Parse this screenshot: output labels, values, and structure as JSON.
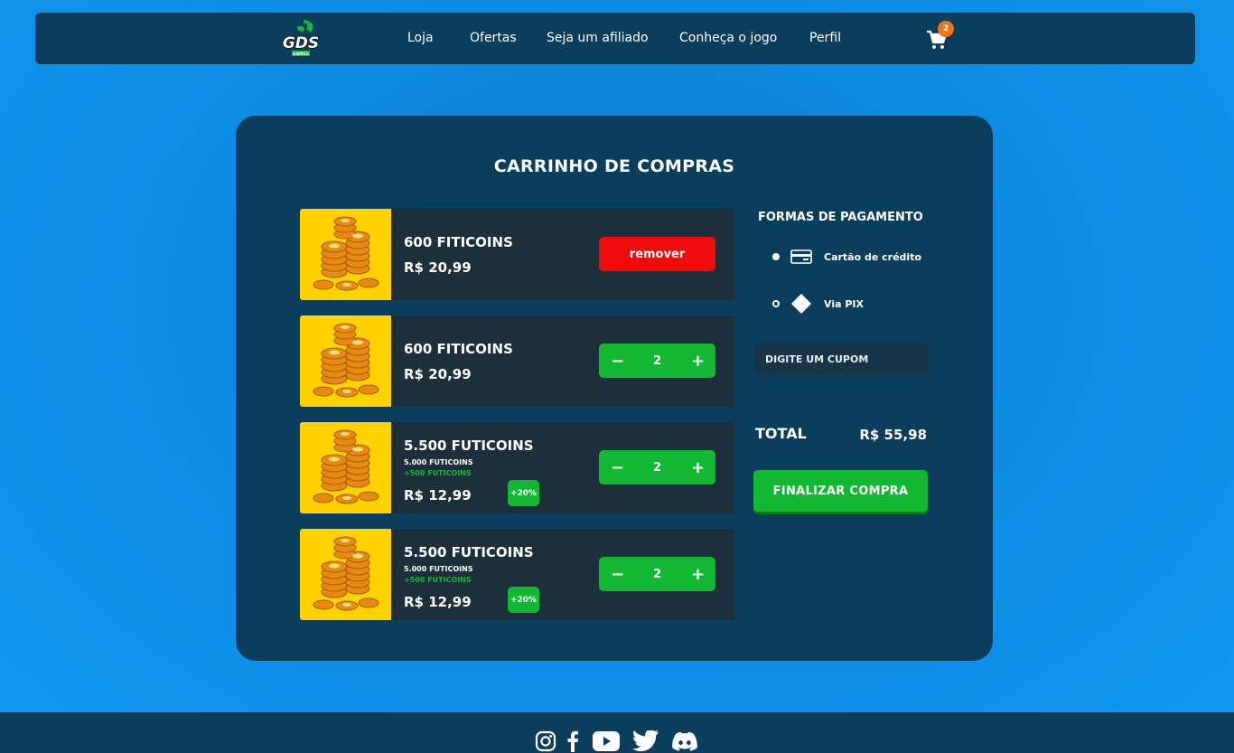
{
  "header": {
    "brand": "GDS GAMES",
    "nav": [
      {
        "label": "Loja"
      },
      {
        "label": "Ofertas"
      },
      {
        "label": "Seja um afiliado"
      },
      {
        "label": "Conheça o jogo"
      },
      {
        "label": "Perfil"
      }
    ],
    "cart_count": "2"
  },
  "cart": {
    "title": "CARRINHO DE COMPRAS",
    "remove_label": "remover",
    "items": [
      {
        "name": "600 FITICOINS",
        "price": "R$ 20,99",
        "quantity": "",
        "base": "",
        "bonus": "",
        "bonus_badge": "",
        "action": "remove"
      },
      {
        "name": "600 FITICOINS",
        "price": "R$ 20,99",
        "quantity": "2",
        "base": "",
        "bonus": "",
        "bonus_badge": "",
        "action": "stepper"
      },
      {
        "name": "5.500 FUTICOINS",
        "price": "R$ 12,99",
        "quantity": "2",
        "base": "5.000 FUTICOINS",
        "bonus": "+500 FUTICOINS",
        "bonus_badge": "+20%",
        "action": "stepper"
      },
      {
        "name": "5.500 FUTICOINS",
        "price": "R$ 12,99",
        "quantity": "2",
        "base": "5.000 FUTICOINS",
        "bonus": "+500 FUTICOINS",
        "bonus_badge": "+20%",
        "action": "stepper"
      }
    ],
    "minus": "−",
    "plus": "+"
  },
  "payment": {
    "title": "FORMAS DE PAGAMENTO",
    "options": [
      {
        "label": "Cartão de crédito",
        "selected": true
      },
      {
        "label": "Via PIX",
        "selected": false
      }
    ]
  },
  "coupon": {
    "placeholder": "DIGITE UM CUPOM"
  },
  "summary": {
    "total_label": "TOTAL",
    "total_value": "R$ 55,98",
    "checkout_label": "FINALIZAR COMPRA"
  },
  "colors": {
    "primary_bg": "#0d8be3",
    "panel": "#0b3d5c",
    "green": "#13b832",
    "red": "#f00c0c",
    "coin_bg": "#ffd200",
    "badge": "#f0731c"
  },
  "footer": {
    "social": [
      "instagram-icon",
      "facebook-icon",
      "youtube-icon",
      "twitter-icon",
      "discord-icon"
    ]
  }
}
